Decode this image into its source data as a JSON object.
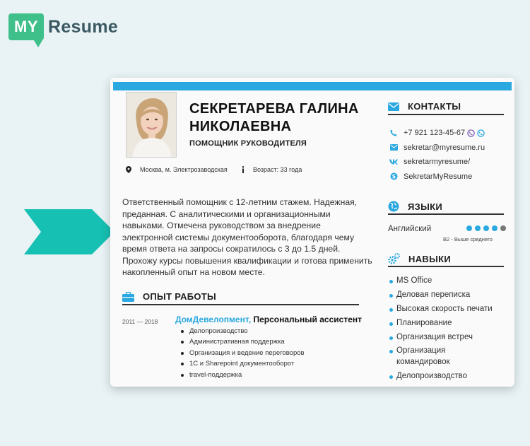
{
  "logo": {
    "badge": "MY",
    "word": "Resume",
    "color": "#3fbf8a"
  },
  "arrow": {
    "icon": "chevron-right-icon",
    "color": "#16c0b2"
  },
  "resume": {
    "accent": "#2aa8e0",
    "name": "СЕКРЕТАРЕВА ГАЛИНА НИКОЛАЕВНА",
    "position": "ПОМОЩНИК РУКОВОДИТЕЛЯ",
    "location": "Москва, м. Электрозаводская",
    "age": "Возраст: 33 года",
    "summary": "Ответственный помощник с 12-летним стажем. Надежная, преданная. С аналитическими и организационными навыками. Отмечена руководством за внедрение электронной системы документооборота, благодаря чему время ответа на запросы сократилось с 3 до 1.5 дней. Прохожу курсы повышения квалификации и готова применить накопленный опыт на новом месте.",
    "experience": {
      "heading": "ОПЫТ РАБОТЫ",
      "years": "2011 — 2018",
      "company": "ДомДевелопмент,",
      "role": " Персональный ассистент",
      "duties": [
        "Делопроизводство",
        "Административная поддержка",
        "Организация и ведение переговоров",
        "1С и Sharepoint документооборот",
        "travel-поддержка"
      ]
    },
    "contacts": {
      "heading": "КОНТАКТЫ",
      "phone": "+7 921 123-45-67",
      "email": "sekretar@myresume.ru",
      "vk": "sekretarmyresume/",
      "skype": "SekretarMyResume"
    },
    "languages": {
      "heading": "ЯЗЫКИ",
      "name": "Английский",
      "level": "B2 - Выше среднего",
      "rating": 4,
      "max": 5
    },
    "skills": {
      "heading": "НАВЫКИ",
      "items": [
        "MS Office",
        "Деловая переписка",
        "Высокая скорость печати",
        "Планирование",
        "Организация встреч",
        "Организация командировок",
        "Делопроизводство"
      ]
    }
  }
}
